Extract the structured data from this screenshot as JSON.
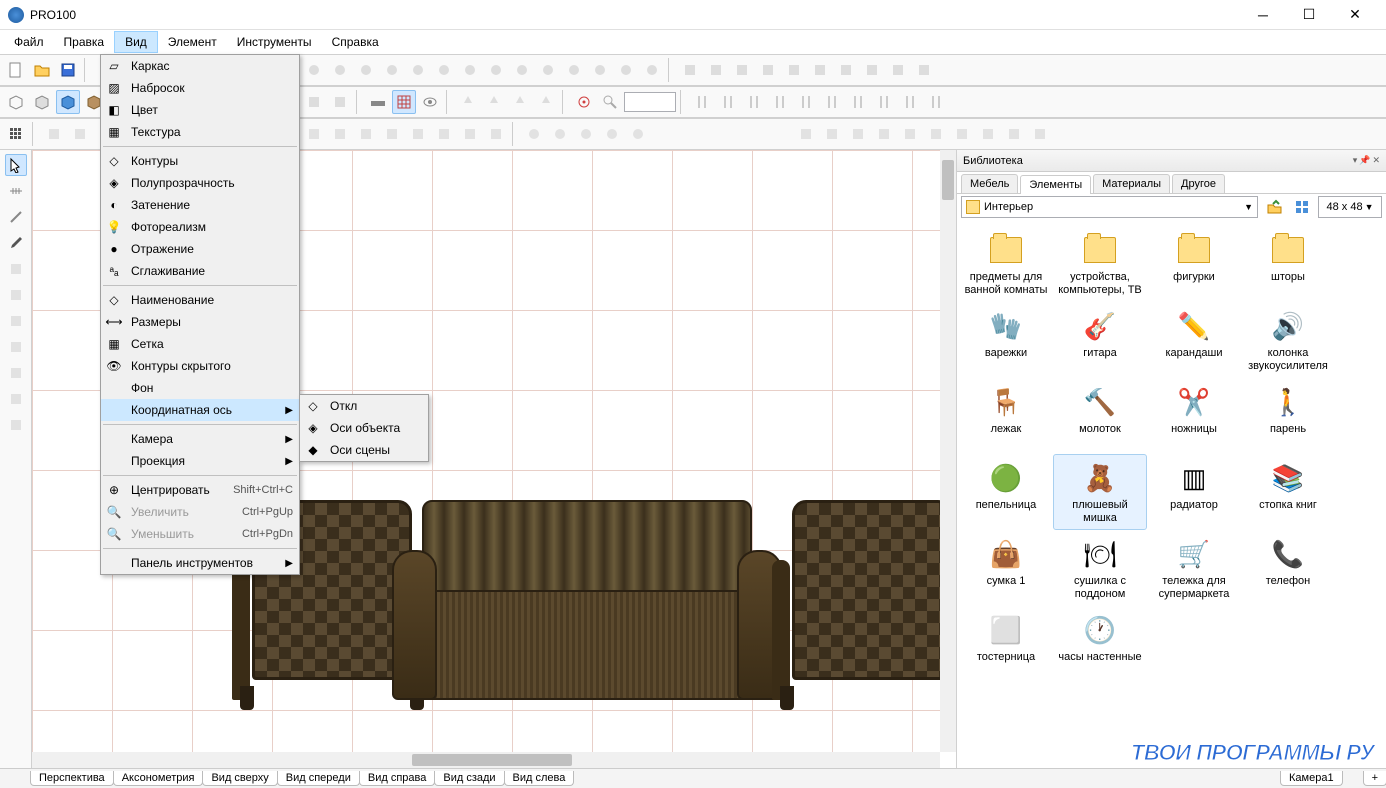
{
  "app_title": "PRO100",
  "menubar": [
    "Файл",
    "Правка",
    "Вид",
    "Элемент",
    "Инструменты",
    "Справка"
  ],
  "active_menu_index": 2,
  "view_menu": {
    "groups": [
      {
        "items": [
          {
            "icon": "wireframe",
            "label": "Каркас"
          },
          {
            "icon": "sketch",
            "label": "Набросок"
          },
          {
            "icon": "color",
            "label": "Цвет"
          },
          {
            "icon": "texture",
            "label": "Текстура"
          }
        ]
      },
      {
        "items": [
          {
            "icon": "contours",
            "label": "Контуры"
          },
          {
            "icon": "transparency",
            "label": "Полупрозрачность"
          },
          {
            "icon": "shading",
            "label": "Затенение"
          },
          {
            "icon": "photoreal",
            "label": "Фотореализм"
          },
          {
            "icon": "reflection",
            "label": "Отражение"
          },
          {
            "icon": "smoothing",
            "label": "Сглаживание"
          }
        ]
      },
      {
        "items": [
          {
            "icon": "name-tag",
            "label": "Наименование"
          },
          {
            "icon": "dimensions",
            "label": "Размеры"
          },
          {
            "icon": "grid",
            "label": "Сетка"
          },
          {
            "icon": "hidden-contours",
            "label": "Контуры скрытого"
          },
          {
            "icon": "background",
            "label": "Фон"
          },
          {
            "icon": "axis",
            "label": "Координатная ось",
            "submenu": true,
            "highlight": true
          }
        ]
      },
      {
        "items": [
          {
            "icon": "camera",
            "label": "Камера",
            "submenu": true
          },
          {
            "icon": "projection",
            "label": "Проекция",
            "submenu": true
          }
        ]
      },
      {
        "items": [
          {
            "icon": "center",
            "label": "Центрировать",
            "shortcut": "Shift+Ctrl+C"
          },
          {
            "icon": "zoom-in",
            "label": "Увеличить",
            "shortcut": "Ctrl+PgUp",
            "disabled": true
          },
          {
            "icon": "zoom-out",
            "label": "Уменьшить",
            "shortcut": "Ctrl+PgDn",
            "disabled": true
          }
        ]
      },
      {
        "items": [
          {
            "icon": "toolbox",
            "label": "Панель инструментов",
            "submenu": true
          }
        ]
      }
    ]
  },
  "axis_submenu": [
    {
      "icon": "axis-off",
      "label": "Откл"
    },
    {
      "icon": "axis-obj",
      "label": "Оси объекта"
    },
    {
      "icon": "axis-scene",
      "label": "Оси сцены"
    }
  ],
  "library": {
    "title": "Библиотека",
    "tabs": [
      "Мебель",
      "Элементы",
      "Материалы",
      "Другое"
    ],
    "active_tab": 1,
    "folder": "Интерьер",
    "size_label": "48 x  48",
    "items": [
      {
        "type": "folder",
        "label": "предметы для ванной комнаты"
      },
      {
        "type": "folder",
        "label": "устройства, компьютеры, ТВ"
      },
      {
        "type": "folder",
        "label": "фигурки"
      },
      {
        "type": "folder",
        "label": "шторы"
      },
      {
        "type": "obj",
        "icon": "mitten",
        "label": "варежки"
      },
      {
        "type": "obj",
        "icon": "guitar",
        "label": "гитара"
      },
      {
        "type": "obj",
        "icon": "pencils",
        "label": "карандаши"
      },
      {
        "type": "obj",
        "icon": "speaker",
        "label": "колонка звукоусилителя"
      },
      {
        "type": "obj",
        "icon": "deckchair",
        "label": "лежак"
      },
      {
        "type": "obj",
        "icon": "hammer",
        "label": "молоток"
      },
      {
        "type": "obj",
        "icon": "scissors",
        "label": "ножницы"
      },
      {
        "type": "obj",
        "icon": "man",
        "label": "парень"
      },
      {
        "type": "obj",
        "icon": "ashtray",
        "label": "пепельница"
      },
      {
        "type": "obj",
        "icon": "teddy",
        "label": "плюшевый мишка",
        "hover": true
      },
      {
        "type": "obj",
        "icon": "radiator",
        "label": "радиатор"
      },
      {
        "type": "obj",
        "icon": "books",
        "label": "стопка книг"
      },
      {
        "type": "obj",
        "icon": "bag",
        "label": "сумка 1"
      },
      {
        "type": "obj",
        "icon": "dishrack",
        "label": "сушилка с поддоном"
      },
      {
        "type": "obj",
        "icon": "cart",
        "label": "тележка для супермаркета"
      },
      {
        "type": "obj",
        "icon": "phone",
        "label": "телефон"
      },
      {
        "type": "obj",
        "icon": "toaster",
        "label": "тостерница"
      },
      {
        "type": "obj",
        "icon": "clock",
        "label": "часы настенные"
      }
    ]
  },
  "view_tabs": [
    "Перспектива",
    "Аксонометрия",
    "Вид сверху",
    "Вид спереди",
    "Вид справа",
    "Вид сзади",
    "Вид слева"
  ],
  "camera_tab": "Камера1",
  "watermark": "ТВОИ ПРОГРАММЫ РУ"
}
